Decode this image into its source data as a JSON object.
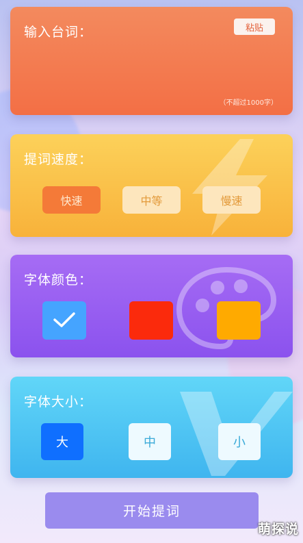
{
  "input_card": {
    "title": "输入台词：",
    "paste_label": "粘贴",
    "hint": "（不超过1000字）",
    "value": ""
  },
  "speed_card": {
    "title": "提词速度：",
    "options": [
      "快速",
      "中等",
      "慢速"
    ],
    "selected": "快速"
  },
  "color_card": {
    "title": "字体颜色：",
    "swatches": [
      "#45a4ff",
      "#fb2a0c",
      "#ffaa00"
    ],
    "selected": "#45a4ff"
  },
  "size_card": {
    "title": "字体大小：",
    "options": [
      "大",
      "中",
      "小"
    ],
    "selected": "大"
  },
  "start_button": "开始提词",
  "watermark": "萌探说",
  "colors": {
    "input_card": "#f36f45",
    "speed_card": "#f8b23a",
    "color_card": "#8b52ee",
    "size_card": "#3fb5ef",
    "start_button": "#9a8bee"
  }
}
